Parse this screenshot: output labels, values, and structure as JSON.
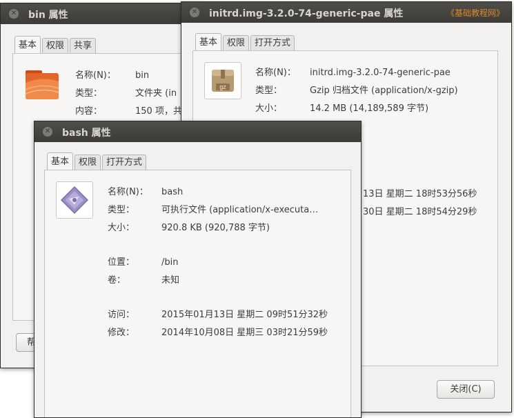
{
  "watermark": "《基础教程网》",
  "bin": {
    "title": "bin 属性",
    "tabs": [
      "基本",
      "权限",
      "共享"
    ],
    "props": [
      {
        "label": "名称(N)：",
        "value": "bin"
      },
      {
        "label": "类型：",
        "value": "文件夹 (in"
      },
      {
        "label": "内容：",
        "value": "150 项，共"
      }
    ],
    "help_label": "帮"
  },
  "initrd": {
    "title": "initrd.img-3.2.0-74-generic-pae 属性",
    "tabs": [
      "基本",
      "权限",
      "打开方式"
    ],
    "props": [
      {
        "label": "名称(N)：",
        "value": "initrd.img-3.2.0-74-generic-pae"
      },
      {
        "label": "类型：",
        "value": "Gzip 归档文件 (application/x-gzip)"
      },
      {
        "label": "大小：",
        "value": "14.2 MB (14,189,589 字节)"
      }
    ],
    "dates": [
      "13日 星期二 18时53分56秒",
      "30日 星期二 18时54分29秒"
    ],
    "icon_text": "gz",
    "close_label": "关闭(C)"
  },
  "bash": {
    "title": "bash 属性",
    "tabs": [
      "基本",
      "权限",
      "打开方式"
    ],
    "props": [
      {
        "label": "名称(N)：",
        "value": "bash"
      },
      {
        "label": "类型：",
        "value": "可执行文件 (application/x-executa…"
      },
      {
        "label": "大小：",
        "value": "920.8 KB (920,788 字节)"
      },
      {
        "label": "位置：",
        "value": "/bin"
      },
      {
        "label": "卷：",
        "value": "未知"
      },
      {
        "label": "访问：",
        "value": "2015年01月13日 星期二 09时51分32秒"
      },
      {
        "label": "修改：",
        "value": "2014年10月08日 星期三 03时21分59秒"
      }
    ]
  }
}
